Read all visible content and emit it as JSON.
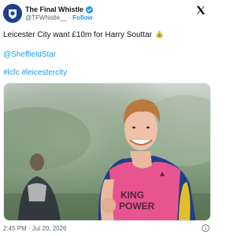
{
  "account": {
    "name": "The Final Whistle",
    "handle": "@TFWhistle__",
    "separator": "·",
    "follow_label": "Follow"
  },
  "tweet": {
    "text": "Leicester City want £10m for Harry Souttar",
    "emoji": "money-bag-icon",
    "mention": "@SheffieldStar",
    "hashtags": "#lcfc #leicestercity",
    "timestamp": "2:45 PM · Jul 20, 2026"
  },
  "photo": {
    "shirt_text_line1": "KING",
    "shirt_text_line2": "POWER"
  },
  "colors": {
    "link": "#1d9bf0",
    "verified": "#1d9bf0",
    "text": "#0f1419",
    "muted": "#536471",
    "shirt": "#e8548f"
  }
}
